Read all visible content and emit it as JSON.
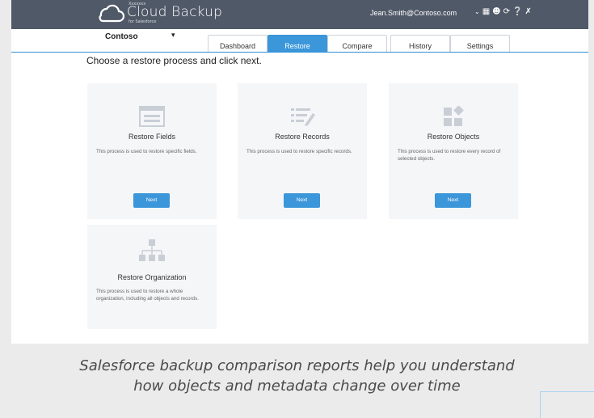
{
  "header": {
    "logo_small_top": "Xxxxxxx",
    "logo_main": "Cloud Backup",
    "logo_small_bottom": "for Salesforce",
    "user_email": "Jean.Smith@Contoso.com"
  },
  "icons": [
    "chevron-down-icon",
    "apps-grid-icon",
    "smiley-icon",
    "refresh-icon",
    "help-icon",
    "tools-icon"
  ],
  "org": {
    "name": "Contoso"
  },
  "tabs": [
    {
      "label": "Dashboard",
      "active": false
    },
    {
      "label": "Restore",
      "active": true
    },
    {
      "label": "Compare",
      "active": false
    },
    {
      "label": "History",
      "active": false
    },
    {
      "label": "Settings",
      "active": false
    }
  ],
  "main": {
    "heading": "Choose a restore process and click next.",
    "cards": [
      {
        "icon": "fields-form-icon",
        "title": "Restore Fields",
        "description": "This process is used to restore specific fields.",
        "button": "Next"
      },
      {
        "icon": "records-list-icon",
        "title": "Restore Records",
        "description": "This process is used to restore specific records.",
        "button": "Next"
      },
      {
        "icon": "objects-blocks-icon",
        "title": "Restore Objects",
        "description": "This process is used to restore every record of selected objects.",
        "button": "Next"
      },
      {
        "icon": "org-chart-icon",
        "title": "Restore Organization",
        "description": "This process is used to restore a whole organization, including all objects and records.",
        "button": null
      }
    ]
  },
  "caption": {
    "line1": "Salesforce backup comparison reports help you understand",
    "line2": "how objects and metadata change over time"
  },
  "colors": {
    "topbar": "#505968",
    "accent": "#3b96da",
    "card_bg": "#f5f6f8",
    "page_bg": "#ebebeb"
  }
}
